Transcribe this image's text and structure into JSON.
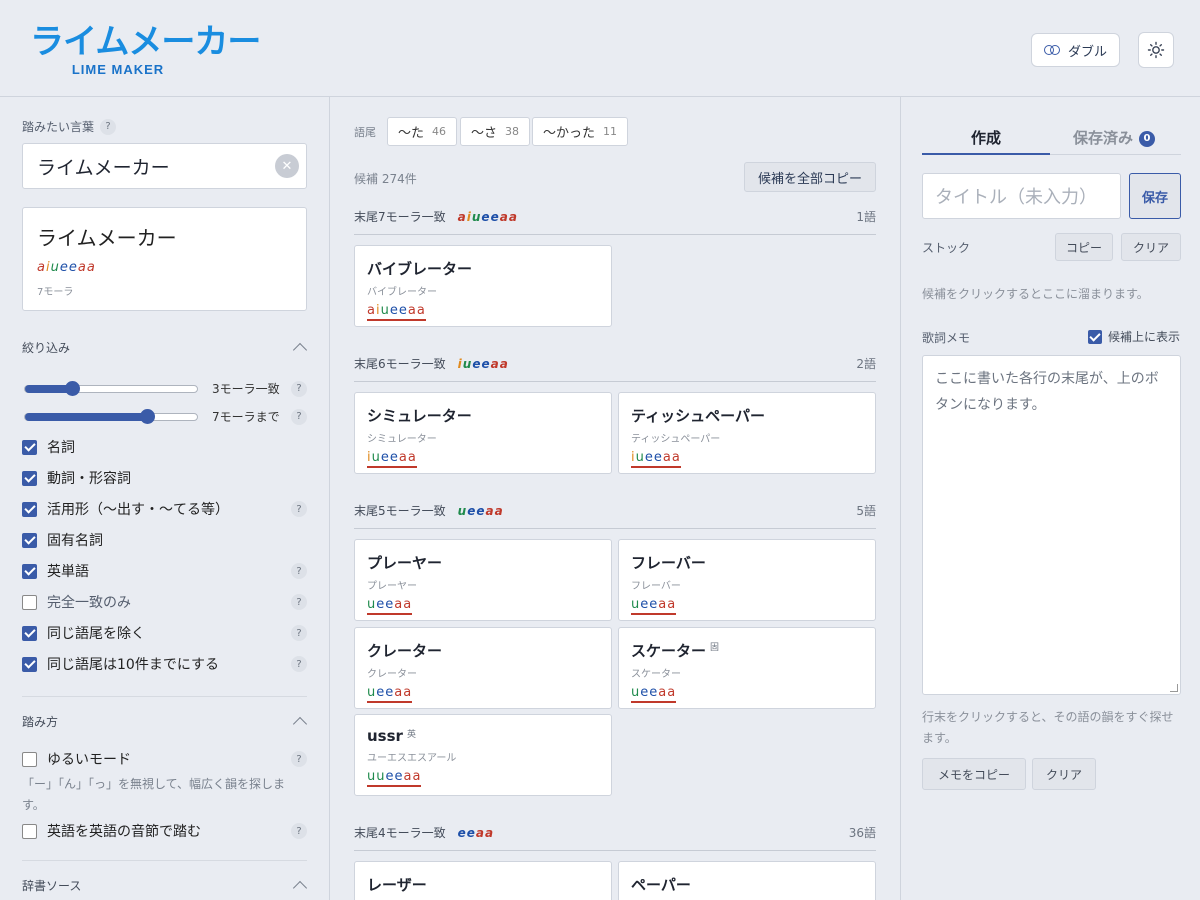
{
  "header": {
    "logo_text": "ライムメーカー",
    "logo_sub": "LIME MAKER",
    "double_button": "ダブル"
  },
  "sidebar": {
    "word_label": "踏みたい言葉",
    "word_value": "ライムメーカー",
    "preview": {
      "word": "ライムメーカー",
      "vowels": "aiueeaa",
      "mora": "7モーラ"
    },
    "filter_title": "絞り込み",
    "slider_min_label": "3モーラ一致",
    "slider_max_label": "7モーラまで",
    "slider_min_value": 3,
    "slider_max_value": 7,
    "checks": [
      {
        "label": "名詞",
        "checked": true
      },
      {
        "label": "動詞・形容詞",
        "checked": true
      },
      {
        "label": "活用形（〜出す・〜てる等）",
        "checked": true
      },
      {
        "label": "固有名詞",
        "checked": true
      },
      {
        "label": "英単語",
        "checked": true
      },
      {
        "label": "完全一致のみ",
        "checked": false
      },
      {
        "label": "同じ語尾を除く",
        "checked": true
      },
      {
        "label": "同じ語尾は10件までにする",
        "checked": true
      }
    ],
    "fumikata_title": "踏み方",
    "loose_mode": "ゆるいモード",
    "loose_note": "「ー」「ん」「っ」を無視して、幅広く韻を探します。",
    "english_syllable": "英語を英語の音節で踏む",
    "dict_title": "辞書ソース"
  },
  "middle": {
    "suffix_label": "語尾",
    "suffix_chips": [
      {
        "label": "〜た",
        "count": "46"
      },
      {
        "label": "〜さ",
        "count": "38"
      },
      {
        "label": "〜かった",
        "count": "11"
      }
    ],
    "candidates": "候補 274件",
    "copy_all": "候補を全部コピー",
    "groups": [
      {
        "title": "末尾7モーラ一致",
        "vowels": "aiueeaa",
        "count": "1語"
      },
      {
        "title": "末尾6モーラ一致",
        "vowels": "iueeaa",
        "count": "2語"
      },
      {
        "title": "末尾5モーラ一致",
        "vowels": "ueeaa",
        "count": "5語"
      },
      {
        "title": "末尾4モーラ一致",
        "vowels": "eeaa",
        "count": "36語"
      }
    ],
    "cards": [
      {
        "word": "バイブレーター",
        "reading": "バイブレーター",
        "vowels": "aiueeaa",
        "tag": ""
      },
      {
        "word": "シミュレーター",
        "reading": "シミュレーター",
        "vowels": "iueeaa",
        "tag": ""
      },
      {
        "word": "ティッシュペーパー",
        "reading": "ティッシュペーパー",
        "vowels": "iueeaa",
        "tag": ""
      },
      {
        "word": "プレーヤー",
        "reading": "プレーヤー",
        "vowels": "ueeaa",
        "tag": ""
      },
      {
        "word": "フレーバー",
        "reading": "フレーバー",
        "vowels": "ueeaa",
        "tag": ""
      },
      {
        "word": "クレーター",
        "reading": "クレーター",
        "vowels": "ueeaa",
        "tag": ""
      },
      {
        "word": "スケーター",
        "reading": "スケーター",
        "vowels": "ueeaa",
        "tag": "固"
      },
      {
        "word": "ussr",
        "reading": "ユーエスエスアール",
        "vowels": "uueeaa",
        "tag": "英"
      },
      {
        "word": "レーザー",
        "reading": "",
        "vowels": "",
        "tag": ""
      },
      {
        "word": "ペーパー",
        "reading": "",
        "vowels": "",
        "tag": ""
      }
    ]
  },
  "right": {
    "tab_create": "作成",
    "tab_saved": "保存済み",
    "saved_count": "0",
    "title_placeholder": "タイトル（未入力）",
    "save": "保存",
    "stock_label": "ストック",
    "copy": "コピー",
    "clear": "クリア",
    "stock_hint": "候補をクリックするとここに溜まります。",
    "memo_label": "歌詞メモ",
    "show_above": "候補上に表示",
    "memo_placeholder": "ここに書いた各行の末尾が、上のボタンになります。",
    "memo_hint": "行末をクリックすると、その語の韻をすぐ探せます。",
    "copy_memo": "メモをコピー",
    "clear_memo": "クリア"
  },
  "colors": {
    "a": "#c0392b",
    "i": "#e08a1e",
    "u": "#1f8a4c",
    "e": "#1d4fa8",
    "accent": "#3a5ba8",
    "logo": "#1a8de0"
  }
}
